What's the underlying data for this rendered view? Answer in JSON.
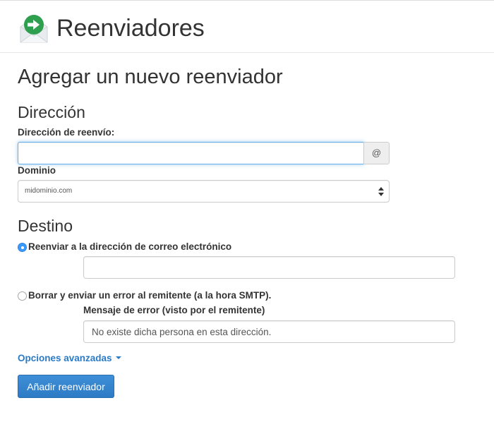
{
  "header": {
    "title": "Reenviadores",
    "icon": "forwarder-envelope-icon"
  },
  "form": {
    "heading": "Agregar un nuevo reenviador",
    "address_section": {
      "title": "Dirección",
      "forward_label": "Dirección de reenvío:",
      "forward_value": "",
      "at_addon": "@",
      "domain_label": "Dominio",
      "domain_selected": "midominio.com"
    },
    "destination_section": {
      "title": "Destino",
      "option_forward": {
        "label": "Reenviar a la dirección de correo electrónico",
        "checked": true,
        "value": ""
      },
      "option_discard": {
        "label": "Borrar y enviar un error al remitente (a la hora SMTP).",
        "checked": false,
        "error_label": "Mensaje de error (visto por el remitente)",
        "error_value": "No existe dicha persona en esta dirección."
      }
    },
    "advanced_link": "Opciones avanzadas",
    "submit_label": "Añadir reenviador"
  },
  "colors": {
    "accent": "#2a7ac5",
    "button": "#337ab7",
    "icon_green": "#2e9e4f",
    "focus_border": "#66afe9",
    "radio_checked": "#3b99fc"
  }
}
